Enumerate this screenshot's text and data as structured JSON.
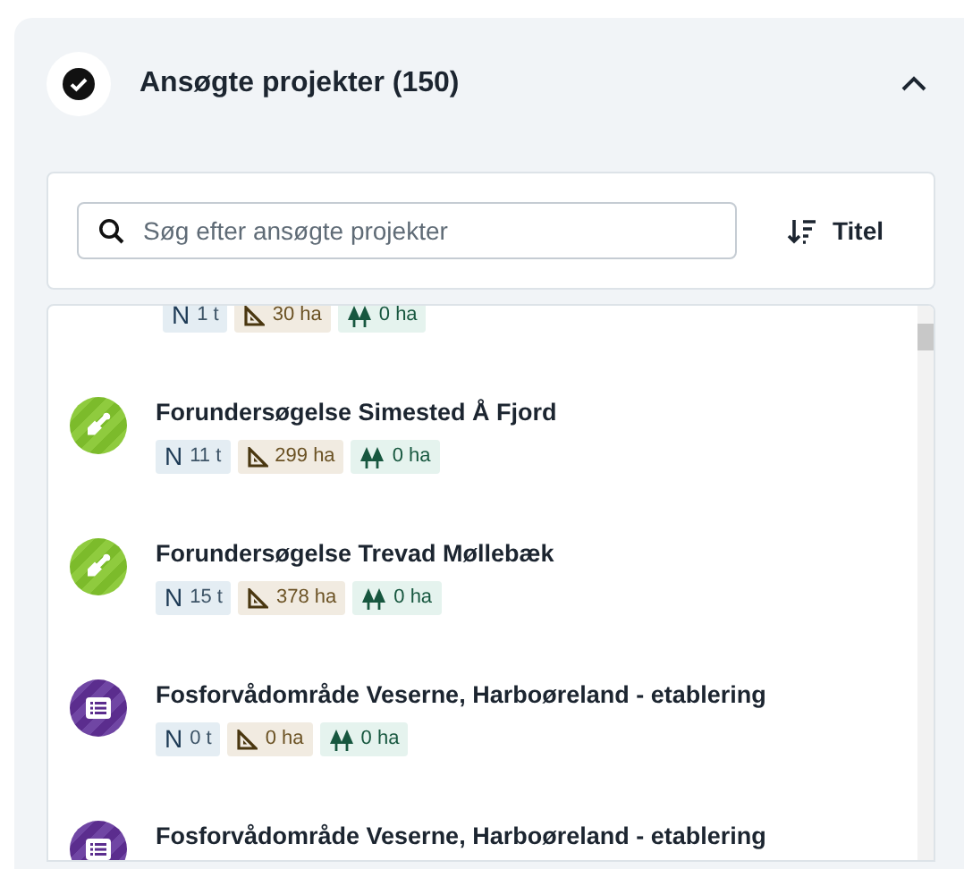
{
  "panel": {
    "title": "Ansøgte projekter (150)",
    "expanded": true
  },
  "search": {
    "placeholder": "Søg efter ansøgte projekter"
  },
  "sort": {
    "label": "Titel"
  },
  "projects": [
    {
      "badges": [
        {
          "kind": "nitrogen",
          "label": "N",
          "text": "1 t"
        },
        {
          "kind": "area",
          "text": "30 ha"
        },
        {
          "kind": "forest",
          "text": "0 ha"
        }
      ]
    },
    {
      "kind": "survey",
      "title": "Forundersøgelse Simested Å Fjord",
      "badges": [
        {
          "kind": "nitrogen",
          "label": "N",
          "text": "11 t"
        },
        {
          "kind": "area",
          "text": "299 ha"
        },
        {
          "kind": "forest",
          "text": "0 ha"
        }
      ]
    },
    {
      "kind": "survey",
      "title": "Forundersøgelse Trevad Møllebæk",
      "badges": [
        {
          "kind": "nitrogen",
          "label": "N",
          "text": "15 t"
        },
        {
          "kind": "area",
          "text": "378 ha"
        },
        {
          "kind": "forest",
          "text": "0 ha"
        }
      ]
    },
    {
      "kind": "wetland",
      "title": "Fosforvådområde Veserne, Harboøreland - etablering",
      "badges": [
        {
          "kind": "nitrogen",
          "label": "N",
          "text": "0 t"
        },
        {
          "kind": "area",
          "text": "0 ha"
        },
        {
          "kind": "forest",
          "text": "0 ha"
        }
      ]
    },
    {
      "kind": "wetland",
      "title": "Fosforvådområde Veserne, Harboøreland - etablering"
    }
  ]
}
